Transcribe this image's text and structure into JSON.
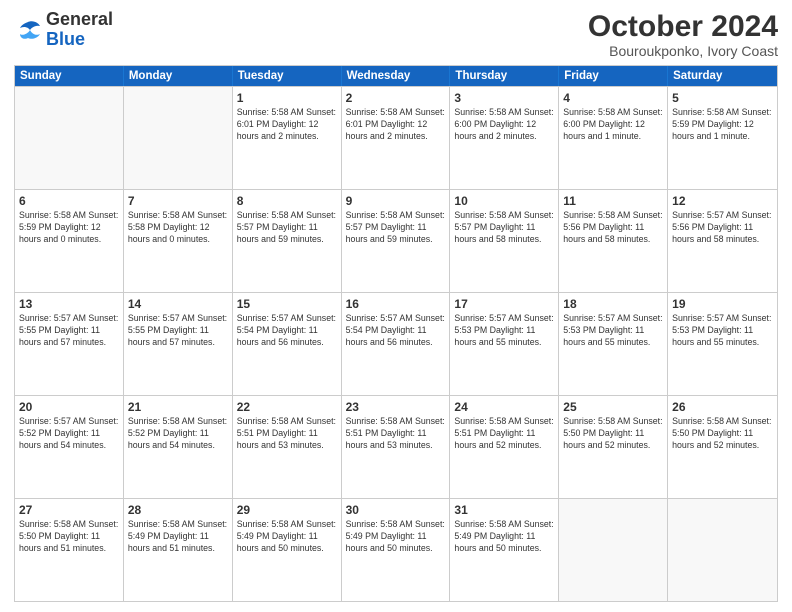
{
  "logo": {
    "line1": "General",
    "line2": "Blue"
  },
  "title": "October 2024",
  "subtitle": "Bouroukponko, Ivory Coast",
  "days": [
    "Sunday",
    "Monday",
    "Tuesday",
    "Wednesday",
    "Thursday",
    "Friday",
    "Saturday"
  ],
  "rows": [
    [
      {
        "day": "",
        "info": ""
      },
      {
        "day": "",
        "info": ""
      },
      {
        "day": "1",
        "info": "Sunrise: 5:58 AM\nSunset: 6:01 PM\nDaylight: 12 hours\nand 2 minutes."
      },
      {
        "day": "2",
        "info": "Sunrise: 5:58 AM\nSunset: 6:01 PM\nDaylight: 12 hours\nand 2 minutes."
      },
      {
        "day": "3",
        "info": "Sunrise: 5:58 AM\nSunset: 6:00 PM\nDaylight: 12 hours\nand 2 minutes."
      },
      {
        "day": "4",
        "info": "Sunrise: 5:58 AM\nSunset: 6:00 PM\nDaylight: 12 hours\nand 1 minute."
      },
      {
        "day": "5",
        "info": "Sunrise: 5:58 AM\nSunset: 5:59 PM\nDaylight: 12 hours\nand 1 minute."
      }
    ],
    [
      {
        "day": "6",
        "info": "Sunrise: 5:58 AM\nSunset: 5:59 PM\nDaylight: 12 hours\nand 0 minutes."
      },
      {
        "day": "7",
        "info": "Sunrise: 5:58 AM\nSunset: 5:58 PM\nDaylight: 12 hours\nand 0 minutes."
      },
      {
        "day": "8",
        "info": "Sunrise: 5:58 AM\nSunset: 5:57 PM\nDaylight: 11 hours\nand 59 minutes."
      },
      {
        "day": "9",
        "info": "Sunrise: 5:58 AM\nSunset: 5:57 PM\nDaylight: 11 hours\nand 59 minutes."
      },
      {
        "day": "10",
        "info": "Sunrise: 5:58 AM\nSunset: 5:57 PM\nDaylight: 11 hours\nand 58 minutes."
      },
      {
        "day": "11",
        "info": "Sunrise: 5:58 AM\nSunset: 5:56 PM\nDaylight: 11 hours\nand 58 minutes."
      },
      {
        "day": "12",
        "info": "Sunrise: 5:57 AM\nSunset: 5:56 PM\nDaylight: 11 hours\nand 58 minutes."
      }
    ],
    [
      {
        "day": "13",
        "info": "Sunrise: 5:57 AM\nSunset: 5:55 PM\nDaylight: 11 hours\nand 57 minutes."
      },
      {
        "day": "14",
        "info": "Sunrise: 5:57 AM\nSunset: 5:55 PM\nDaylight: 11 hours\nand 57 minutes."
      },
      {
        "day": "15",
        "info": "Sunrise: 5:57 AM\nSunset: 5:54 PM\nDaylight: 11 hours\nand 56 minutes."
      },
      {
        "day": "16",
        "info": "Sunrise: 5:57 AM\nSunset: 5:54 PM\nDaylight: 11 hours\nand 56 minutes."
      },
      {
        "day": "17",
        "info": "Sunrise: 5:57 AM\nSunset: 5:53 PM\nDaylight: 11 hours\nand 55 minutes."
      },
      {
        "day": "18",
        "info": "Sunrise: 5:57 AM\nSunset: 5:53 PM\nDaylight: 11 hours\nand 55 minutes."
      },
      {
        "day": "19",
        "info": "Sunrise: 5:57 AM\nSunset: 5:53 PM\nDaylight: 11 hours\nand 55 minutes."
      }
    ],
    [
      {
        "day": "20",
        "info": "Sunrise: 5:57 AM\nSunset: 5:52 PM\nDaylight: 11 hours\nand 54 minutes."
      },
      {
        "day": "21",
        "info": "Sunrise: 5:58 AM\nSunset: 5:52 PM\nDaylight: 11 hours\nand 54 minutes."
      },
      {
        "day": "22",
        "info": "Sunrise: 5:58 AM\nSunset: 5:51 PM\nDaylight: 11 hours\nand 53 minutes."
      },
      {
        "day": "23",
        "info": "Sunrise: 5:58 AM\nSunset: 5:51 PM\nDaylight: 11 hours\nand 53 minutes."
      },
      {
        "day": "24",
        "info": "Sunrise: 5:58 AM\nSunset: 5:51 PM\nDaylight: 11 hours\nand 52 minutes."
      },
      {
        "day": "25",
        "info": "Sunrise: 5:58 AM\nSunset: 5:50 PM\nDaylight: 11 hours\nand 52 minutes."
      },
      {
        "day": "26",
        "info": "Sunrise: 5:58 AM\nSunset: 5:50 PM\nDaylight: 11 hours\nand 52 minutes."
      }
    ],
    [
      {
        "day": "27",
        "info": "Sunrise: 5:58 AM\nSunset: 5:50 PM\nDaylight: 11 hours\nand 51 minutes."
      },
      {
        "day": "28",
        "info": "Sunrise: 5:58 AM\nSunset: 5:49 PM\nDaylight: 11 hours\nand 51 minutes."
      },
      {
        "day": "29",
        "info": "Sunrise: 5:58 AM\nSunset: 5:49 PM\nDaylight: 11 hours\nand 50 minutes."
      },
      {
        "day": "30",
        "info": "Sunrise: 5:58 AM\nSunset: 5:49 PM\nDaylight: 11 hours\nand 50 minutes."
      },
      {
        "day": "31",
        "info": "Sunrise: 5:58 AM\nSunset: 5:49 PM\nDaylight: 11 hours\nand 50 minutes."
      },
      {
        "day": "",
        "info": ""
      },
      {
        "day": "",
        "info": ""
      }
    ]
  ]
}
